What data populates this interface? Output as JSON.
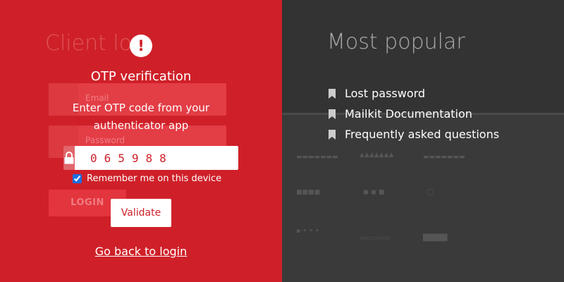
{
  "login_bg": {
    "title": "Client lo",
    "email_placeholder": "Email",
    "password_placeholder": "Password",
    "login_button": "LOGIN"
  },
  "otp": {
    "title": "OTP verification",
    "instructions": "Enter OTP code from your authenticator app",
    "code": "065988",
    "remember_label": "Remember me on this device",
    "remember_checked": true,
    "validate_button": "Validate",
    "back_link": "Go back to login"
  },
  "popular": {
    "title": "Most popular",
    "items": [
      {
        "label": "Lost password",
        "icon": "bookmark-icon"
      },
      {
        "label": "Mailkit Documentation",
        "icon": "bookmark-icon"
      },
      {
        "label": "Frequently asked questions",
        "icon": "bookmark-icon"
      }
    ]
  },
  "colors": {
    "brand_red": "#cf2029",
    "dark_bg": "#333333",
    "white": "#ffffff"
  }
}
